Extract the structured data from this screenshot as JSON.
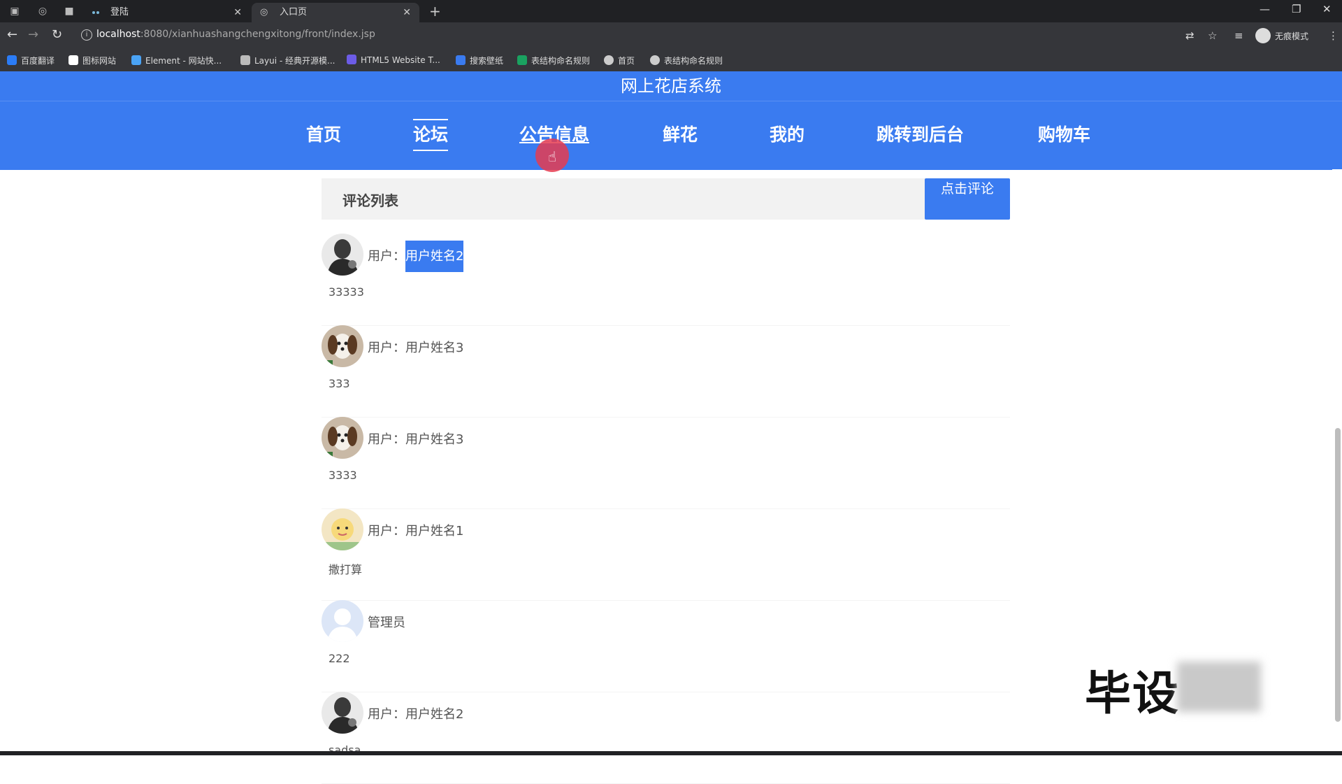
{
  "browser": {
    "tabs": [
      {
        "title": "登陆"
      },
      {
        "title": "入口页"
      }
    ],
    "url_host": "localhost",
    "url_path": ":8080/xianhuashangchengxitong/front/index.jsp",
    "incognito_label": "无痕模式",
    "bookmarks": [
      {
        "label": "百度翻译",
        "color": "#2b7cf6"
      },
      {
        "label": "图标网站",
        "color": "#ffffff"
      },
      {
        "label": "Element - 网站快...",
        "color": "#4aa3f5"
      },
      {
        "label": "Layui - 经典开源模...",
        "color": "#bbbbbb"
      },
      {
        "label": "HTML5 Website T...",
        "color": "#6c5ce7"
      },
      {
        "label": "搜索壁纸",
        "color": "#3a7bf0"
      },
      {
        "label": "表结构命名规则",
        "color": "#1aa260"
      },
      {
        "label": "首页",
        "color": "#cccccc"
      },
      {
        "label": "表结构命名规则",
        "color": "#cccccc"
      }
    ]
  },
  "site": {
    "brand": "网上花店系统",
    "nav": [
      {
        "label": "首页"
      },
      {
        "label": "论坛"
      },
      {
        "label": "公告信息"
      },
      {
        "label": "鲜花"
      },
      {
        "label": "我的"
      },
      {
        "label": "跳转到后台"
      },
      {
        "label": "购物车"
      }
    ],
    "active_nav": "论坛"
  },
  "comments": {
    "header": "评论列表",
    "button_label": "点击评论",
    "items": [
      {
        "prefix": "用户：",
        "name": "用户姓名2",
        "text": "33333",
        "avatar": "dark-person"
      },
      {
        "prefix": "用户：",
        "name": "用户姓名3",
        "text": "333",
        "avatar": "dog"
      },
      {
        "prefix": "用户：",
        "name": "用户姓名3",
        "text": "3333",
        "avatar": "dog"
      },
      {
        "prefix": "用户：",
        "name": "用户姓名1",
        "text": "撒打算",
        "avatar": "cartoon"
      },
      {
        "prefix": "",
        "name": "管理员",
        "text": "222",
        "avatar": "default"
      },
      {
        "prefix": "用户：",
        "name": "用户姓名2",
        "text": "sadsa",
        "avatar": "dark-person"
      }
    ]
  },
  "watermark": "毕设",
  "colors": {
    "accent": "#3a7bf0",
    "chrome": "#35363a"
  }
}
